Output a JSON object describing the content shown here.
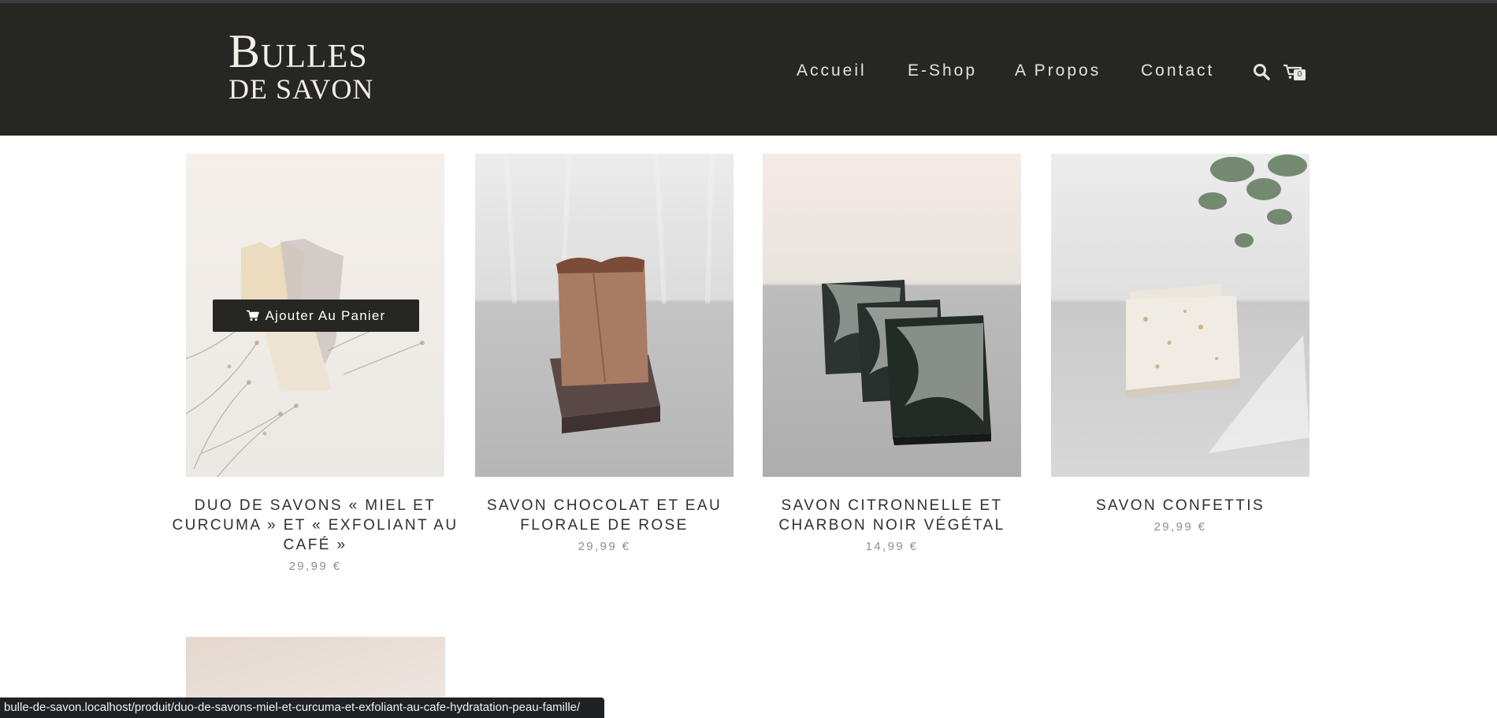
{
  "brand": {
    "line1": "Bulles",
    "line2": "de savon"
  },
  "nav": [
    {
      "label": "Accueil"
    },
    {
      "label": "E-Shop"
    },
    {
      "label": "A Propos"
    },
    {
      "label": "Contact"
    }
  ],
  "header_icons": {
    "search": "search-icon",
    "cart": "cart-icon",
    "cart_count": "0"
  },
  "products": [
    {
      "title_lines": [
        "DUO DE SAVONS « MIEL ET",
        "CURCUMA » ET « EXFOLIANT AU",
        "CAFÉ »"
      ],
      "price": "29,99 €"
    },
    {
      "title_lines": [
        "SAVON CHOCOLAT ET EAU",
        "FLORALE DE ROSE"
      ],
      "price": "29,99 €"
    },
    {
      "title_lines": [
        "SAVON CITRONNELLE ET",
        "CHARBON NOIR VÉGÉTAL"
      ],
      "price": "14,99 €"
    },
    {
      "title_lines": [
        "SAVON CONFETTIS"
      ],
      "price": "29,99 €"
    }
  ],
  "hover_action": {
    "label": "Ajouter Au Panier",
    "icon": "cart-icon"
  },
  "status_url": "bulle-de-savon.localhost/produit/duo-de-savons-miel-et-curcuma-et-exfoliant-au-cafe-hydratation-peau-famille/",
  "colors": {
    "header_bg": "#262622",
    "nav_text": "#e4e2dc",
    "title_text": "#2f2f2f",
    "price_text": "#8d8d8d",
    "button_bg": "#262622"
  }
}
